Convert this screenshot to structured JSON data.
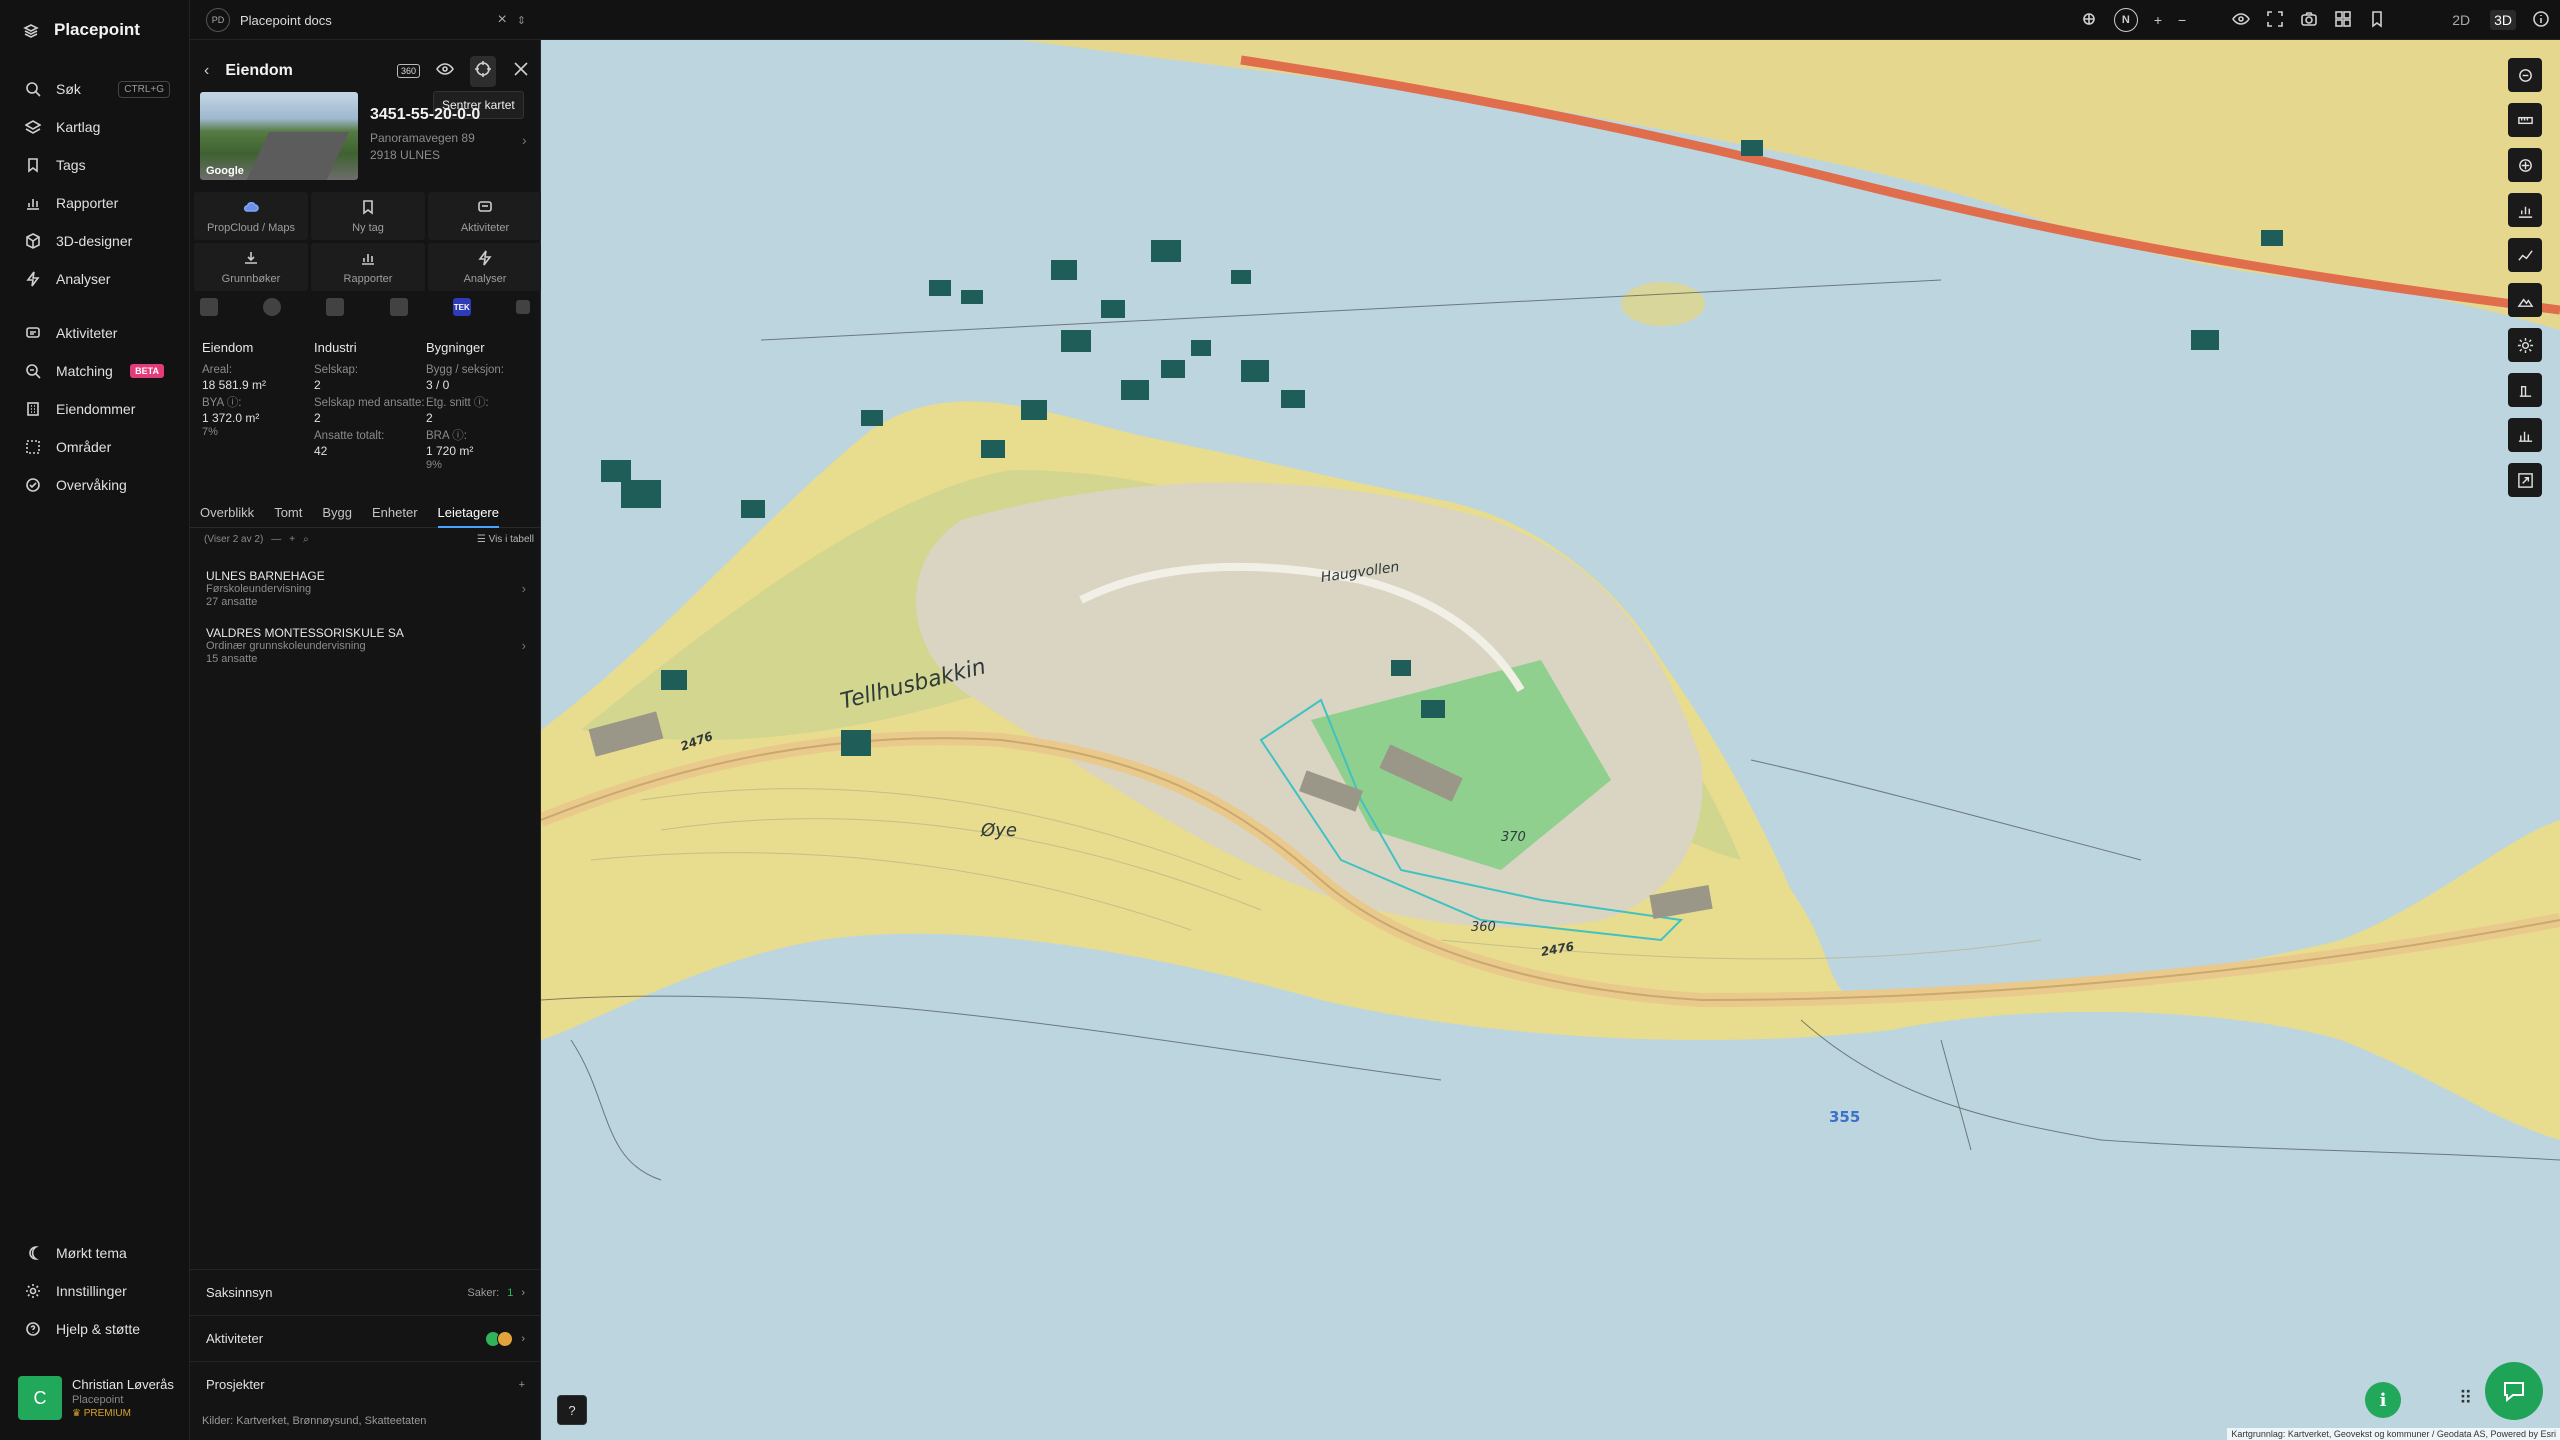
{
  "app": {
    "brand": "Placepoint"
  },
  "nav": {
    "items": [
      {
        "label": "Søk",
        "kbd": "CTRL+G",
        "icon": "search-icon"
      },
      {
        "label": "Kartlag",
        "icon": "layers-icon"
      },
      {
        "label": "Tags",
        "icon": "bookmark-icon"
      },
      {
        "label": "Rapporter",
        "icon": "chart-icon"
      },
      {
        "label": "3D-designer",
        "icon": "cube-icon"
      },
      {
        "label": "Analyser",
        "icon": "bolt-icon"
      }
    ],
    "items2": [
      {
        "label": "Aktiviteter",
        "icon": "activity-icon"
      },
      {
        "label": "Matching",
        "badge": "BETA",
        "icon": "match-icon"
      },
      {
        "label": "Eiendommer",
        "icon": "building-icon"
      },
      {
        "label": "Områder",
        "icon": "area-icon"
      },
      {
        "label": "Overvåking",
        "icon": "monitor-icon"
      }
    ],
    "bottom": [
      {
        "label": "Mørkt tema",
        "icon": "moon-icon"
      },
      {
        "label": "Innstillinger",
        "icon": "gear-icon"
      },
      {
        "label": "Hjelp & støtte",
        "icon": "help-icon"
      }
    ],
    "user": {
      "initial": "C",
      "name": "Christian Løverås",
      "org": "Placepoint",
      "plan": "PREMIUM"
    }
  },
  "topbar": {
    "doc_badge": "PD",
    "doc_title": "Placepoint docs",
    "north": "N",
    "view_2d": "2D",
    "view_3d": "3D"
  },
  "panel": {
    "title": "Eiendom",
    "badge_360": "360",
    "tooltip": "Sentrer kartet",
    "thumb_label": "Google",
    "prop_id": "3451-55-20-0-0",
    "address_line1": "Panoramavegen 89",
    "address_line2": "2918 ULNES",
    "actions": [
      {
        "label": "PropCloud / Maps",
        "icon": "cloud-icon"
      },
      {
        "label": "Ny tag",
        "icon": "bookmark-icon"
      },
      {
        "label": "Aktiviteter",
        "icon": "activity-icon"
      },
      {
        "label": "Grunnbøker",
        "icon": "download-icon"
      },
      {
        "label": "Rapporter",
        "icon": "chart-icon"
      },
      {
        "label": "Analyser",
        "icon": "bolt-icon"
      }
    ],
    "source_tek": "TEK",
    "stats": {
      "eiendom": {
        "head": "Eiendom",
        "areal_label": "Areal:",
        "areal": "18 581.9 m²",
        "bya_label": "BYA ⓘ:",
        "bya": "1 372.0 m²",
        "bya_pct": "7%"
      },
      "industri": {
        "head": "Industri",
        "selskap_label": "Selskap:",
        "selskap": "2",
        "ansatte_label": "Selskap med ansatte:",
        "ansatte": "2",
        "total_label": "Ansatte totalt:",
        "total": "42"
      },
      "bygninger": {
        "head": "Bygninger",
        "bygg_label": "Bygg / seksjon:",
        "bygg": "3 / 0",
        "etg_label": "Etg. snitt ⓘ:",
        "etg": "2",
        "bra_label": "BRA ⓘ:",
        "bra": "1 720 m²",
        "bra_pct": "9%"
      }
    },
    "tabs": [
      "Overblikk",
      "Tomt",
      "Bygg",
      "Enheter",
      "Leietagere"
    ],
    "active_tab": "Leietagere",
    "list_count": "(Viser 2 av 2)",
    "vis_i_tabell": "Vis i tabell",
    "tenants": [
      {
        "name": "ULNES BARNEHAGE",
        "desc": "Førskoleundervisning",
        "emp": "27 ansatte"
      },
      {
        "name": "VALDRES MONTESSORISKULE SA",
        "desc": "Ordinær grunnskoleundervisning",
        "emp": "15 ansatte"
      }
    ],
    "sections": {
      "saksinnsyn": "Saksinnsyn",
      "saker_label": "Saker:",
      "saker_count": "1",
      "aktiviteter": "Aktiviteter",
      "prosjekter": "Prosjekter",
      "plus": "+"
    },
    "sources_label": "Kilder:",
    "sources": [
      "Kartverket,",
      "Brønnøysund,",
      "Skatteetaten"
    ]
  },
  "map": {
    "labels": {
      "road1": "Tellhusbakkin",
      "area1": "Øye",
      "road2": "Haugvollen",
      "depth": "355",
      "r2476a": "2476",
      "r2476b": "2476",
      "c370": "370",
      "c360": "360"
    },
    "attribution": "Kartgrunnlag: Kartverket, Geovekst og kommuner / Geodata AS, Powered by Esri",
    "colors": {
      "water": "#bcd5df",
      "land": "#eadf9e",
      "farmland": "#e8dc8e",
      "forest": "#c9d48e",
      "field": "#8fd08f",
      "road_main": "#e9c98c",
      "road_e": "#e06d4b",
      "building": "#1f5e58",
      "accent": "#21a85a"
    }
  }
}
